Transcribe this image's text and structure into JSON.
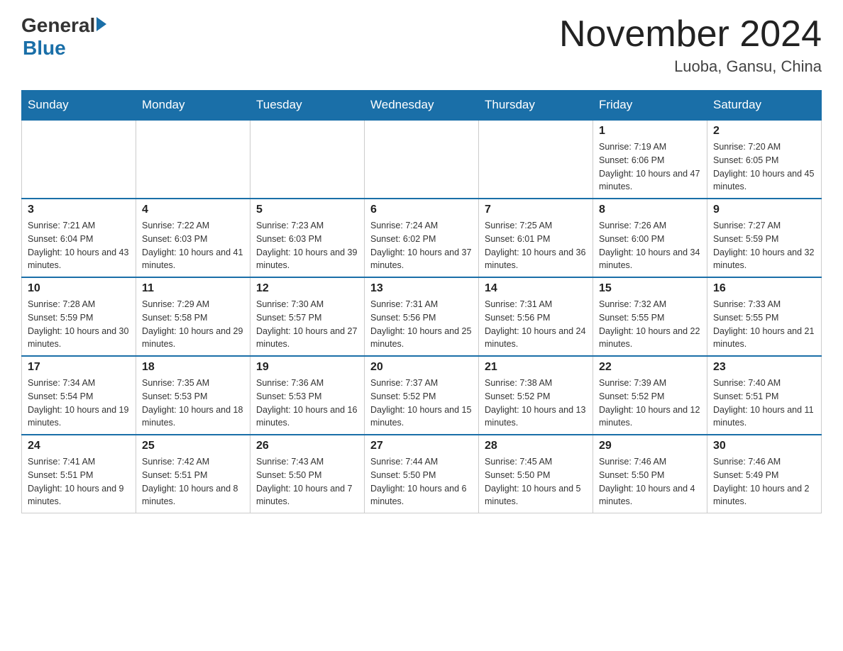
{
  "header": {
    "logo_general": "General",
    "logo_blue": "Blue",
    "month_title": "November 2024",
    "location": "Luoba, Gansu, China"
  },
  "days_of_week": [
    "Sunday",
    "Monday",
    "Tuesday",
    "Wednesday",
    "Thursday",
    "Friday",
    "Saturday"
  ],
  "weeks": [
    [
      {
        "day": "",
        "info": ""
      },
      {
        "day": "",
        "info": ""
      },
      {
        "day": "",
        "info": ""
      },
      {
        "day": "",
        "info": ""
      },
      {
        "day": "",
        "info": ""
      },
      {
        "day": "1",
        "info": "Sunrise: 7:19 AM\nSunset: 6:06 PM\nDaylight: 10 hours and 47 minutes."
      },
      {
        "day": "2",
        "info": "Sunrise: 7:20 AM\nSunset: 6:05 PM\nDaylight: 10 hours and 45 minutes."
      }
    ],
    [
      {
        "day": "3",
        "info": "Sunrise: 7:21 AM\nSunset: 6:04 PM\nDaylight: 10 hours and 43 minutes."
      },
      {
        "day": "4",
        "info": "Sunrise: 7:22 AM\nSunset: 6:03 PM\nDaylight: 10 hours and 41 minutes."
      },
      {
        "day": "5",
        "info": "Sunrise: 7:23 AM\nSunset: 6:03 PM\nDaylight: 10 hours and 39 minutes."
      },
      {
        "day": "6",
        "info": "Sunrise: 7:24 AM\nSunset: 6:02 PM\nDaylight: 10 hours and 37 minutes."
      },
      {
        "day": "7",
        "info": "Sunrise: 7:25 AM\nSunset: 6:01 PM\nDaylight: 10 hours and 36 minutes."
      },
      {
        "day": "8",
        "info": "Sunrise: 7:26 AM\nSunset: 6:00 PM\nDaylight: 10 hours and 34 minutes."
      },
      {
        "day": "9",
        "info": "Sunrise: 7:27 AM\nSunset: 5:59 PM\nDaylight: 10 hours and 32 minutes."
      }
    ],
    [
      {
        "day": "10",
        "info": "Sunrise: 7:28 AM\nSunset: 5:59 PM\nDaylight: 10 hours and 30 minutes."
      },
      {
        "day": "11",
        "info": "Sunrise: 7:29 AM\nSunset: 5:58 PM\nDaylight: 10 hours and 29 minutes."
      },
      {
        "day": "12",
        "info": "Sunrise: 7:30 AM\nSunset: 5:57 PM\nDaylight: 10 hours and 27 minutes."
      },
      {
        "day": "13",
        "info": "Sunrise: 7:31 AM\nSunset: 5:56 PM\nDaylight: 10 hours and 25 minutes."
      },
      {
        "day": "14",
        "info": "Sunrise: 7:31 AM\nSunset: 5:56 PM\nDaylight: 10 hours and 24 minutes."
      },
      {
        "day": "15",
        "info": "Sunrise: 7:32 AM\nSunset: 5:55 PM\nDaylight: 10 hours and 22 minutes."
      },
      {
        "day": "16",
        "info": "Sunrise: 7:33 AM\nSunset: 5:55 PM\nDaylight: 10 hours and 21 minutes."
      }
    ],
    [
      {
        "day": "17",
        "info": "Sunrise: 7:34 AM\nSunset: 5:54 PM\nDaylight: 10 hours and 19 minutes."
      },
      {
        "day": "18",
        "info": "Sunrise: 7:35 AM\nSunset: 5:53 PM\nDaylight: 10 hours and 18 minutes."
      },
      {
        "day": "19",
        "info": "Sunrise: 7:36 AM\nSunset: 5:53 PM\nDaylight: 10 hours and 16 minutes."
      },
      {
        "day": "20",
        "info": "Sunrise: 7:37 AM\nSunset: 5:52 PM\nDaylight: 10 hours and 15 minutes."
      },
      {
        "day": "21",
        "info": "Sunrise: 7:38 AM\nSunset: 5:52 PM\nDaylight: 10 hours and 13 minutes."
      },
      {
        "day": "22",
        "info": "Sunrise: 7:39 AM\nSunset: 5:52 PM\nDaylight: 10 hours and 12 minutes."
      },
      {
        "day": "23",
        "info": "Sunrise: 7:40 AM\nSunset: 5:51 PM\nDaylight: 10 hours and 11 minutes."
      }
    ],
    [
      {
        "day": "24",
        "info": "Sunrise: 7:41 AM\nSunset: 5:51 PM\nDaylight: 10 hours and 9 minutes."
      },
      {
        "day": "25",
        "info": "Sunrise: 7:42 AM\nSunset: 5:51 PM\nDaylight: 10 hours and 8 minutes."
      },
      {
        "day": "26",
        "info": "Sunrise: 7:43 AM\nSunset: 5:50 PM\nDaylight: 10 hours and 7 minutes."
      },
      {
        "day": "27",
        "info": "Sunrise: 7:44 AM\nSunset: 5:50 PM\nDaylight: 10 hours and 6 minutes."
      },
      {
        "day": "28",
        "info": "Sunrise: 7:45 AM\nSunset: 5:50 PM\nDaylight: 10 hours and 5 minutes."
      },
      {
        "day": "29",
        "info": "Sunrise: 7:46 AM\nSunset: 5:50 PM\nDaylight: 10 hours and 4 minutes."
      },
      {
        "day": "30",
        "info": "Sunrise: 7:46 AM\nSunset: 5:49 PM\nDaylight: 10 hours and 2 minutes."
      }
    ]
  ]
}
